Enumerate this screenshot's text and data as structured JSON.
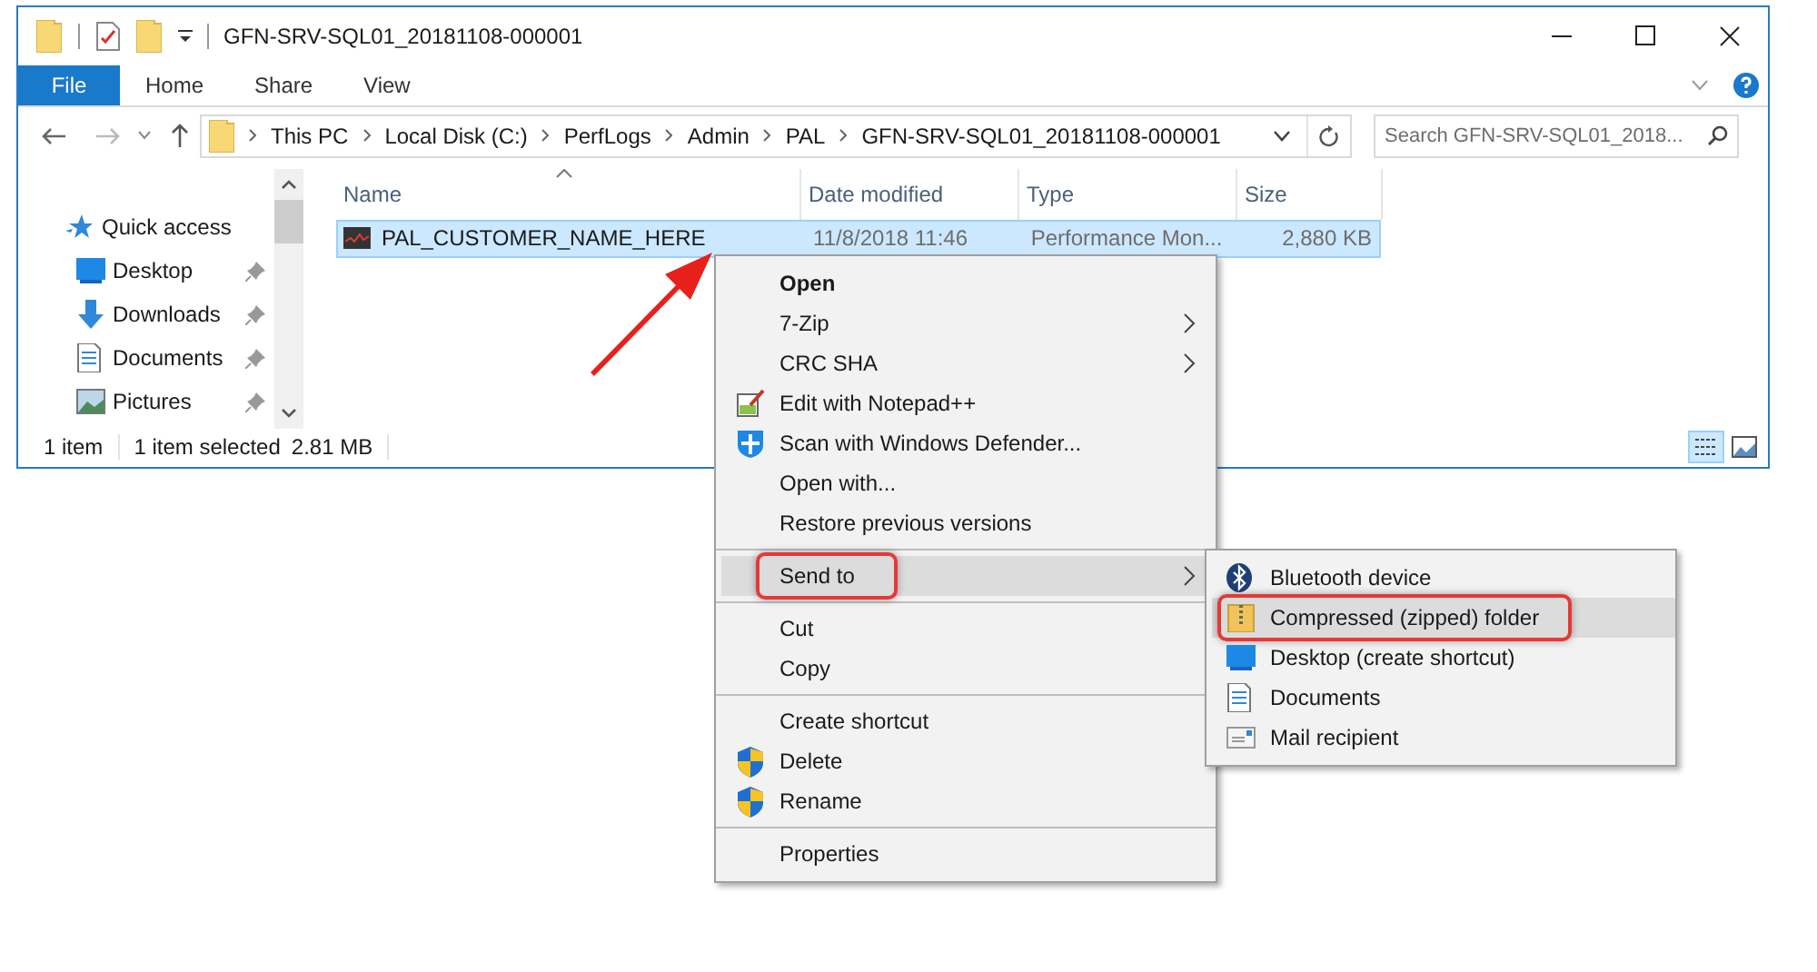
{
  "window": {
    "title": "GFN-SRV-SQL01_20181108-000001"
  },
  "ribbon_tabs": [
    {
      "label": "File",
      "kind": "file"
    },
    {
      "label": "Home",
      "kind": "tab"
    },
    {
      "label": "Share",
      "kind": "tab"
    },
    {
      "label": "View",
      "kind": "tab"
    }
  ],
  "address_bar": {
    "breadcrumbs": [
      "This PC",
      "Local Disk (C:)",
      "PerfLogs",
      "Admin",
      "PAL",
      "GFN-SRV-SQL01_20181108-000001"
    ]
  },
  "search": {
    "placeholder": "Search GFN-SRV-SQL01_2018..."
  },
  "navigation": [
    {
      "label": "Quick access",
      "kind": "star",
      "pinned": false
    },
    {
      "label": "Desktop",
      "kind": "desktop",
      "pinned": true
    },
    {
      "label": "Downloads",
      "kind": "download",
      "pinned": true
    },
    {
      "label": "Documents",
      "kind": "document",
      "pinned": true
    },
    {
      "label": "Pictures",
      "kind": "picture",
      "pinned": true
    }
  ],
  "columns": [
    "Name",
    "Date modified",
    "Type",
    "Size"
  ],
  "files": [
    {
      "name": "PAL_CUSTOMER_NAME_HERE",
      "date_modified": "11/8/2018 11:46",
      "type": "Performance Mon...",
      "size": "2,880 KB",
      "selected": true
    }
  ],
  "status_bar": {
    "item_count": "1 item",
    "selection": "1 item selected",
    "selection_size": "2.81 MB"
  },
  "context_menu": {
    "groups": [
      [
        {
          "label": "Open",
          "bold": true,
          "submenu": false,
          "kind": "plain",
          "selected": false,
          "highlighted": false
        },
        {
          "label": "7-Zip",
          "bold": false,
          "submenu": true,
          "kind": "plain",
          "selected": false,
          "highlighted": false
        },
        {
          "label": "CRC SHA",
          "bold": false,
          "submenu": true,
          "kind": "plain",
          "selected": false,
          "highlighted": false
        },
        {
          "label": "Edit with Notepad++",
          "bold": false,
          "submenu": false,
          "kind": "notepad",
          "selected": false,
          "highlighted": false
        },
        {
          "label": "Scan with Windows Defender...",
          "bold": false,
          "submenu": false,
          "kind": "defender",
          "selected": false,
          "highlighted": false
        },
        {
          "label": "Open with...",
          "bold": false,
          "submenu": false,
          "kind": "plain",
          "selected": false,
          "highlighted": false
        },
        {
          "label": "Restore previous versions",
          "bold": false,
          "submenu": false,
          "kind": "plain",
          "selected": false,
          "highlighted": false
        }
      ],
      [
        {
          "label": "Send to",
          "bold": false,
          "submenu": true,
          "kind": "plain",
          "selected": true,
          "highlighted": true
        }
      ],
      [
        {
          "label": "Cut",
          "bold": false,
          "submenu": false,
          "kind": "plain",
          "selected": false,
          "highlighted": false
        },
        {
          "label": "Copy",
          "bold": false,
          "submenu": false,
          "kind": "plain",
          "selected": false,
          "highlighted": false
        }
      ],
      [
        {
          "label": "Create shortcut",
          "bold": false,
          "submenu": false,
          "kind": "plain",
          "selected": false,
          "highlighted": false
        },
        {
          "label": "Delete",
          "bold": false,
          "submenu": false,
          "kind": "shield",
          "selected": false,
          "highlighted": false
        },
        {
          "label": "Rename",
          "bold": false,
          "submenu": false,
          "kind": "shield",
          "selected": false,
          "highlighted": false
        }
      ],
      [
        {
          "label": "Properties",
          "bold": false,
          "submenu": false,
          "kind": "plain",
          "selected": false,
          "highlighted": false
        }
      ]
    ]
  },
  "send_to_menu": {
    "items": [
      {
        "label": "Bluetooth device",
        "kind": "bluetooth",
        "selected": false,
        "highlighted": false
      },
      {
        "label": "Compressed (zipped) folder",
        "kind": "zip",
        "selected": true,
        "highlighted": true
      },
      {
        "label": "Desktop (create shortcut)",
        "kind": "desktop",
        "selected": false,
        "highlighted": false
      },
      {
        "label": "Documents",
        "kind": "document",
        "selected": false,
        "highlighted": false
      },
      {
        "label": "Mail recipient",
        "kind": "mail",
        "selected": false,
        "highlighted": false
      }
    ]
  }
}
